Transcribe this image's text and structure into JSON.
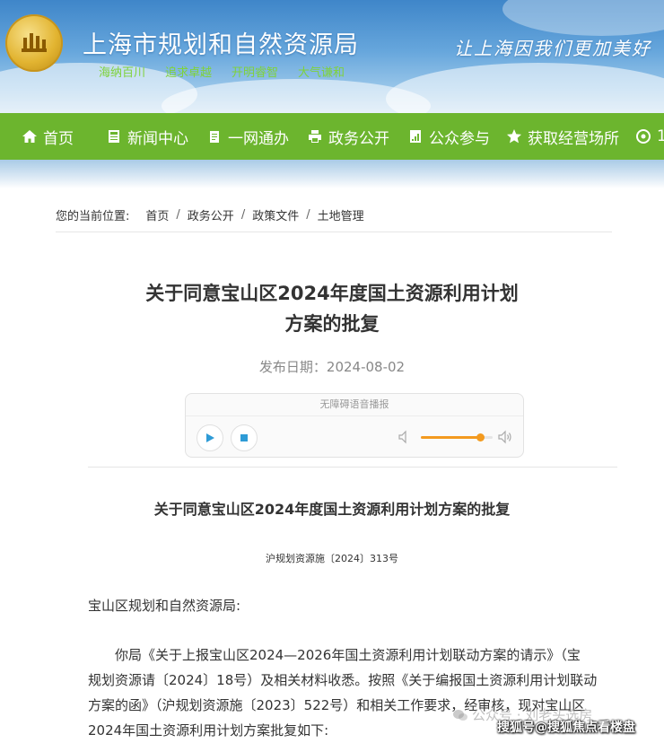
{
  "site": {
    "title": "上海市规划和自然资源局",
    "mottos": [
      "海纳百川",
      "追求卓越",
      "开明睿智",
      "大气谦和"
    ],
    "slogan": "让上海因我们更加美好"
  },
  "nav": {
    "items": [
      {
        "label": "首页",
        "icon": "home-icon"
      },
      {
        "label": "新闻中心",
        "icon": "newspaper-icon"
      },
      {
        "label": "一网通办",
        "icon": "clipboard-icon"
      },
      {
        "label": "政务公开",
        "icon": "printer-icon"
      },
      {
        "label": "公众参与",
        "icon": "chart-doc-icon"
      },
      {
        "label": "获取经营场所",
        "icon": "star-icon"
      },
      {
        "label": "1",
        "icon": "settings-icon"
      }
    ]
  },
  "breadcrumb": {
    "prefix": "您的当前位置:",
    "items": [
      "首页",
      "政务公开",
      "政策文件",
      "土地管理"
    ],
    "separator": "/"
  },
  "article": {
    "title_line1": "关于同意宝山区2024年度国土资源利用计划",
    "title_line2": "方案的批复",
    "pubdate": "发布日期：2024-08-02",
    "player": {
      "header": "无障碍语音播报",
      "volume": 0.82
    },
    "heading": "关于同意宝山区2024年度国土资源利用计划方案的批复",
    "doc_number": "沪规划资源施〔2024〕313号",
    "salutation": "宝山区规划和自然资源局:",
    "para_lines": [
      "你局《关于上报宝山区2024—2026年国土资源利用计划联动方案的请示》（宝",
      "规划资源请〔2024〕18号）及相关材料收悉。按照《关于编报国土资源利用计划联动",
      "方案的函》（沪规划资源施〔2023〕522号）和相关工作要求，经审核，现对宝山区",
      "2024年国土资源利用计划方案批复如下:"
    ]
  },
  "watermarks": {
    "wechat": "公众号 · 刘老头选房",
    "sohu": "搜狐号@搜狐焦点看楼盘"
  }
}
